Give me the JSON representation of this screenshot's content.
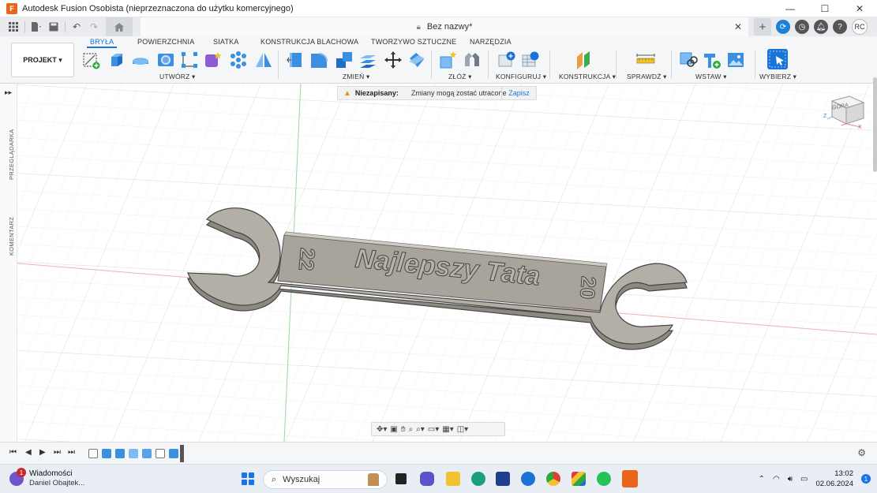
{
  "window": {
    "title": "Autodesk Fusion Osobista (nieprzeznaczona do użytku komercyjnego)",
    "minimize": "—",
    "maximize": "☐",
    "close": "✕"
  },
  "tabbar": {
    "document_title": "Bez nazwy*",
    "close": "✕",
    "plus": "+",
    "user_initials": "RC"
  },
  "ribbon": {
    "tabs": [
      "BRYŁA",
      "POWIERZCHNIA",
      "SIATKA",
      "KONSTRUKCJA BLACHOWA",
      "TWORZYWO SZTUCZNE",
      "NARZĘDZIA"
    ],
    "active_tab": "BRYŁA",
    "project_button": "PROJEKT ▾",
    "groups": [
      "UTWÓRZ ▾",
      "ZMIEŃ ▾",
      "ZŁÓŻ ▾",
      "KONFIGURUJ ▾",
      "KONSTRUKCJA ▾",
      "SPRAWDŹ ▾",
      "WSTAW ▾",
      "WYBIERZ ▾"
    ]
  },
  "left_rail": {
    "expand": "▸▸",
    "browser_label": "PRZEGLĄDARKA",
    "comments_label": "KOMENTARZ"
  },
  "notice": {
    "icon": "warning-icon",
    "title": "Niezapisany:",
    "message": "Zmiany mogą zostać utracone",
    "save": "Zapisz"
  },
  "viewcube": {
    "face": "GÓRA",
    "axis_x": "X",
    "axis_z": "Z"
  },
  "model": {
    "text": "Najlepszy Tata",
    "left_size": "22",
    "right_size": "20"
  },
  "nav_bar": {
    "icons": [
      "orbit-icon",
      "look-at-icon",
      "pan-icon",
      "zoom-icon",
      "zoom-window-icon",
      "display-settings-icon",
      "grid-settings-icon",
      "viewports-icon"
    ]
  },
  "timeline": {
    "buttons": [
      "⏮",
      "◀",
      "▶",
      "⏭"
    ],
    "settings_icon": "gear-icon"
  },
  "taskbar": {
    "notification_badge": "1",
    "notification_app": "Wiadomości",
    "notification_sender": "Daniel Obajtek...",
    "search_placeholder": "Wyszukaj",
    "time": "13:02",
    "date": "02.06.2024",
    "tray_badge": "1"
  },
  "colors": {
    "accent": "#1b73d6",
    "model_fill": "#a8a49b",
    "grid": "#e3e3e3",
    "axis_red": "#e8b5b5",
    "axis_green": "#9fd59f"
  }
}
